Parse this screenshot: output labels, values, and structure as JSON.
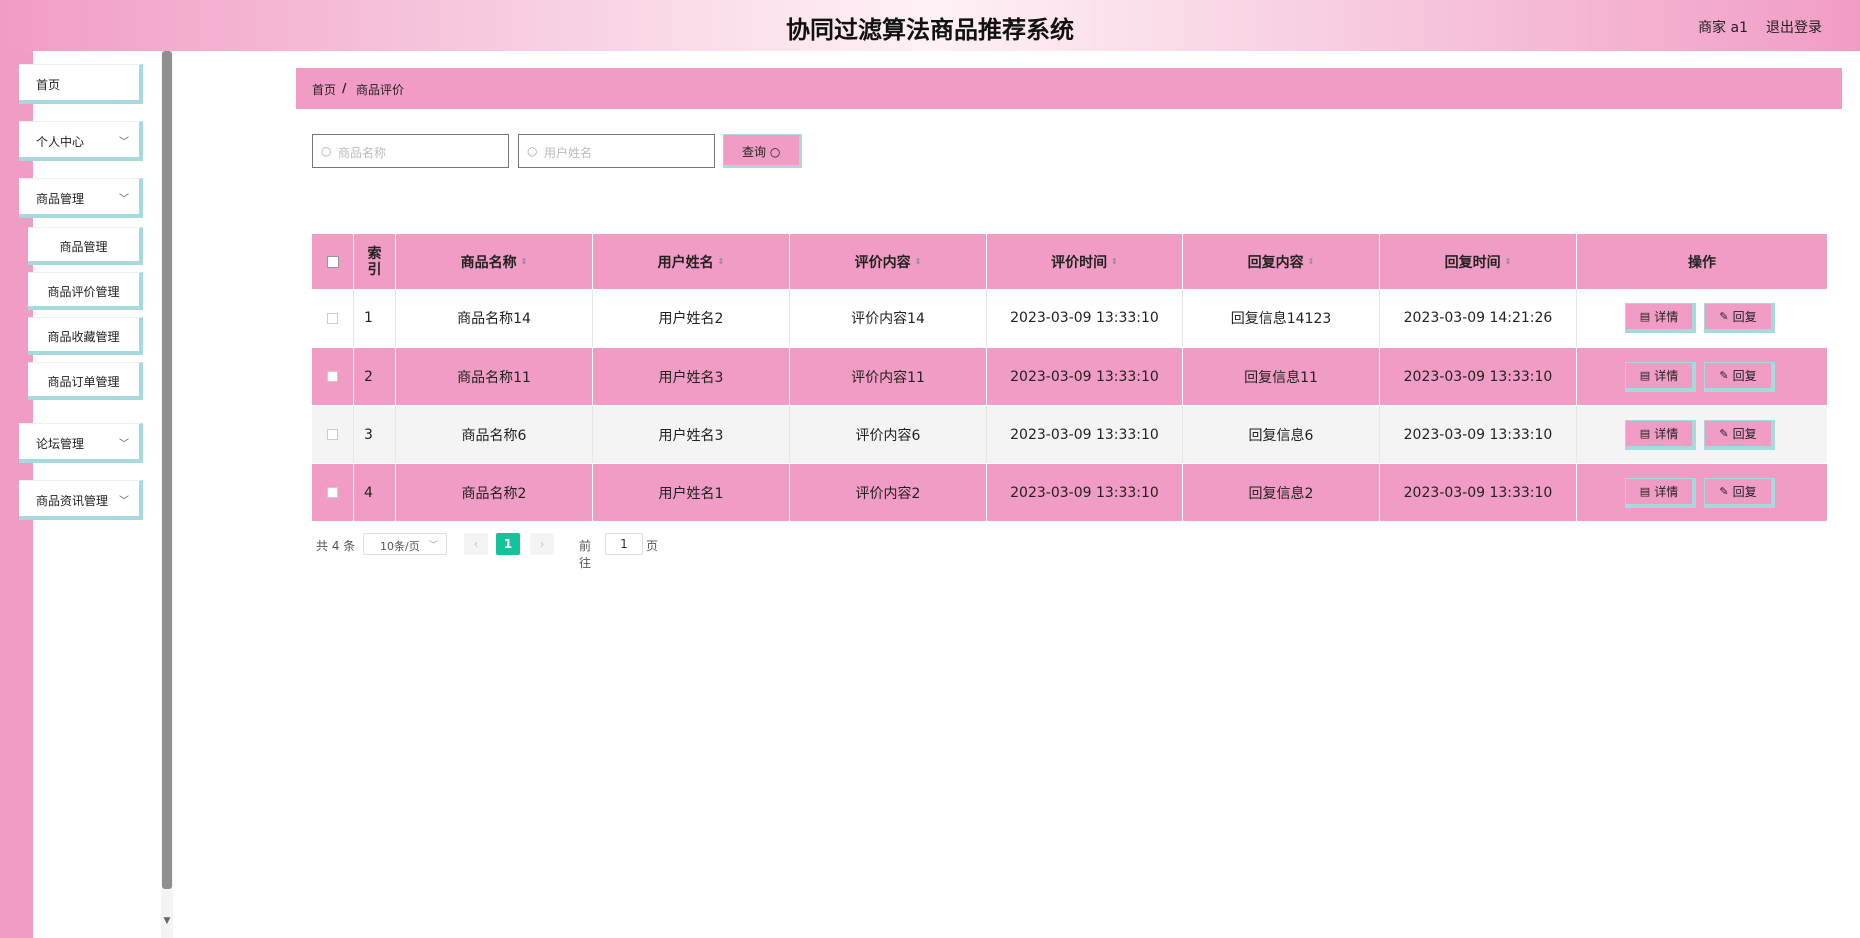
{
  "header": {
    "title": "协同过滤算法商品推荐系统",
    "user": "商家 a1",
    "logout": "退出登录"
  },
  "sidebar": {
    "items": [
      {
        "label": "首页"
      },
      {
        "label": "个人中心"
      },
      {
        "label": "商品管理"
      },
      {
        "label": "论坛管理"
      },
      {
        "label": "商品资讯管理"
      }
    ],
    "subitems": [
      {
        "label": "商品管理"
      },
      {
        "label": "商品评价管理"
      },
      {
        "label": "商品收藏管理"
      },
      {
        "label": "商品订单管理"
      }
    ]
  },
  "breadcrumb": {
    "home": "首页",
    "sep": "/",
    "current": "商品评价"
  },
  "search": {
    "product_placeholder": "商品名称",
    "user_placeholder": "用户姓名",
    "button": "查询"
  },
  "table": {
    "headers": {
      "index": "索引",
      "product": "商品名称",
      "user": "用户姓名",
      "content": "评价内容",
      "time": "评价时间",
      "reply": "回复内容",
      "reply_time": "回复时间",
      "actions": "操作"
    },
    "rows": [
      {
        "index": "1",
        "product": "商品名称14",
        "user": "用户姓名2",
        "content": "评价内容14",
        "time": "2023-03-09 13:33:10",
        "reply": "回复信息14123",
        "reply_time": "2023-03-09 14:21:26"
      },
      {
        "index": "2",
        "product": "商品名称11",
        "user": "用户姓名3",
        "content": "评价内容11",
        "time": "2023-03-09 13:33:10",
        "reply": "回复信息11",
        "reply_time": "2023-03-09 13:33:10"
      },
      {
        "index": "3",
        "product": "商品名称6",
        "user": "用户姓名3",
        "content": "评价内容6",
        "time": "2023-03-09 13:33:10",
        "reply": "回复信息6",
        "reply_time": "2023-03-09 13:33:10"
      },
      {
        "index": "4",
        "product": "商品名称2",
        "user": "用户姓名1",
        "content": "评价内容2",
        "time": "2023-03-09 13:33:10",
        "reply": "回复信息2",
        "reply_time": "2023-03-09 13:33:10"
      }
    ],
    "detail_label": "详情",
    "reply_label": "回复"
  },
  "pager": {
    "total": "共 4 条",
    "page_size": "10条/页",
    "current_page": "1",
    "goto_prefix": "前往",
    "goto_value": "1",
    "goto_suffix": "页"
  },
  "colors": {
    "pink": "#f19cc4",
    "teal_border": "#a6dadd",
    "active_page": "#13c39a"
  }
}
